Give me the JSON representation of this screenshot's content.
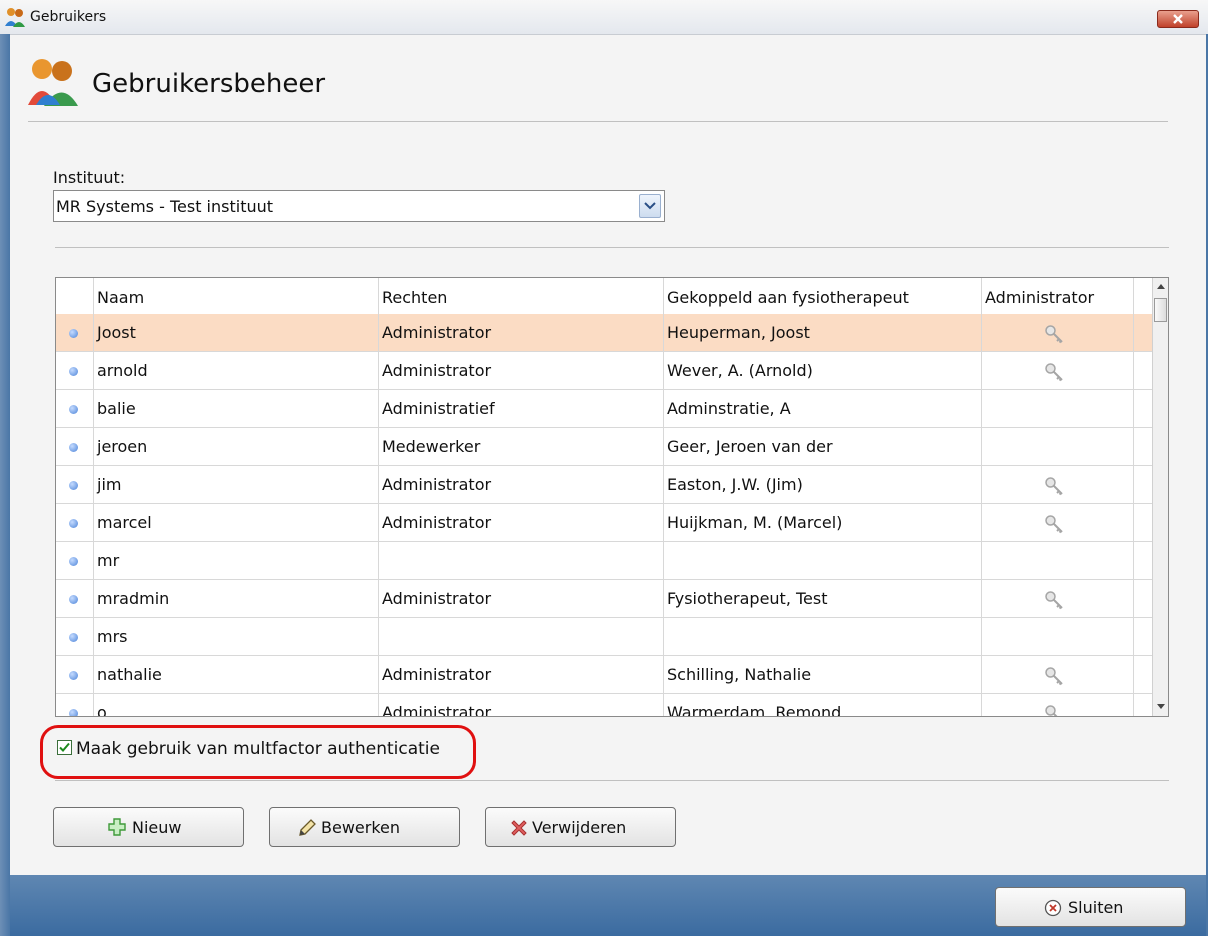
{
  "window": {
    "title": "Gebruikers",
    "close_label": "close"
  },
  "header": {
    "title": "Gebruikersbeheer"
  },
  "institute": {
    "label": "Instituut:",
    "selected": "MR Systems - Test instituut"
  },
  "table": {
    "columns": [
      "Naam",
      "Rechten",
      "Gekoppeld aan fysiotherapeut",
      "Administrator"
    ],
    "rows": [
      {
        "naam": "Joost",
        "rechten": "Administrator",
        "fysio": "Heuperman, Joost",
        "admin": true,
        "selected": true
      },
      {
        "naam": "arnold",
        "rechten": "Administrator",
        "fysio": "Wever, A.  (Arnold)",
        "admin": true
      },
      {
        "naam": "balie",
        "rechten": "Administratief",
        "fysio": "Adminstratie, A",
        "admin": false
      },
      {
        "naam": "jeroen",
        "rechten": "Medewerker",
        "fysio": "Geer, Jeroen van der",
        "admin": false
      },
      {
        "naam": "jim",
        "rechten": "Administrator",
        "fysio": "Easton, J.W.  (Jim)",
        "admin": true
      },
      {
        "naam": "marcel",
        "rechten": "Administrator",
        "fysio": "Huijkman, M.  (Marcel)",
        "admin": true
      },
      {
        "naam": "mr",
        "rechten": "",
        "fysio": "",
        "admin": false
      },
      {
        "naam": "mradmin",
        "rechten": "Administrator",
        "fysio": "Fysiotherapeut, Test",
        "admin": true
      },
      {
        "naam": "mrs",
        "rechten": "",
        "fysio": "",
        "admin": false
      },
      {
        "naam": "nathalie",
        "rechten": "Administrator",
        "fysio": "Schilling, Nathalie",
        "admin": true
      },
      {
        "naam": "o",
        "rechten": "Administrator",
        "fysio": "Warmerdam, Remond",
        "admin": true
      }
    ]
  },
  "mfa": {
    "label": "Maak gebruik van multfactor authenticatie",
    "checked": true
  },
  "buttons": {
    "new": "Nieuw",
    "edit": "Bewerken",
    "delete": "Verwijderen",
    "close": "Sluiten"
  },
  "colors": {
    "selected_row": "#fbdcc4",
    "highlight": "#e01010",
    "footer": "#4a76a6"
  }
}
